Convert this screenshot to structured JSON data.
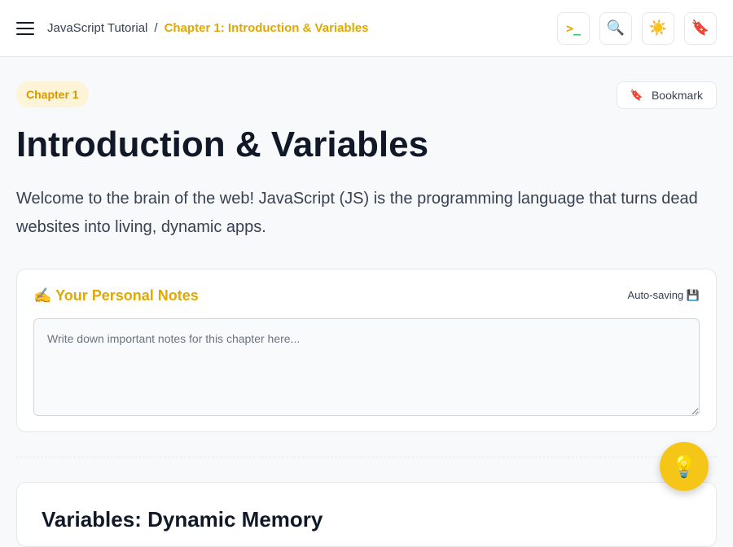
{
  "header": {
    "breadcrumb_root": "JavaScript Tutorial",
    "breadcrumb_sep": "/",
    "breadcrumb_current": "Chapter 1: Introduction & Variables",
    "actions": {
      "terminal_prompt": ">",
      "terminal_cursor": "_",
      "search_glyph": "🔍",
      "theme_glyph": "☀️",
      "bookmark_glyph": "🔖"
    }
  },
  "chapter": {
    "badge": "Chapter 1",
    "bookmark_label": "Bookmark",
    "bookmark_glyph": "🔖",
    "title": "Introduction & Variables",
    "intro": "Welcome to the brain of the web! JavaScript (JS) is the programming language that turns dead websites into living, dynamic apps."
  },
  "notes": {
    "title": "✍️ Your Personal Notes",
    "autosave": "Auto-saving 💾",
    "placeholder": "Write down important notes for this chapter here..."
  },
  "next_section": {
    "title": "Variables: Dynamic Memory"
  },
  "fab": {
    "glyph": "💡"
  },
  "colors": {
    "accent": "#e0a800",
    "badge_bg": "#fdf3d6",
    "fab": "#f5c518",
    "text_dark": "#111827"
  }
}
